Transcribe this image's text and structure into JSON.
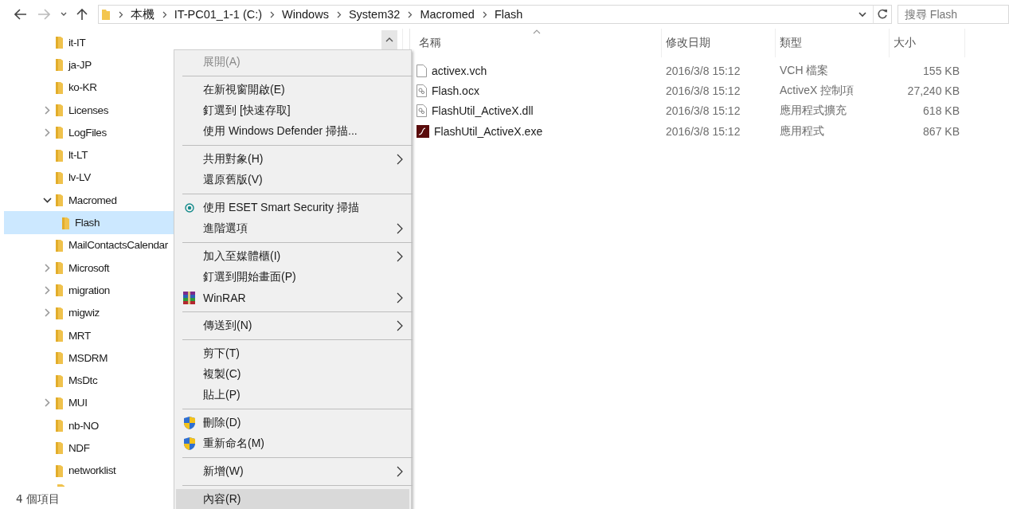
{
  "address": {
    "segments": [
      "本機",
      "IT-PC01_1-1 (C:)",
      "Windows",
      "System32",
      "Macromed",
      "Flash"
    ]
  },
  "search": {
    "placeholder": "搜尋 Flash"
  },
  "nav_tree": [
    {
      "label": "it-IT",
      "expandable": false,
      "selected": false
    },
    {
      "label": "ja-JP",
      "expandable": false,
      "selected": false
    },
    {
      "label": "ko-KR",
      "expandable": false,
      "selected": false
    },
    {
      "label": "Licenses",
      "expandable": true,
      "expanded": false,
      "selected": false
    },
    {
      "label": "LogFiles",
      "expandable": true,
      "expanded": false,
      "selected": false
    },
    {
      "label": "lt-LT",
      "expandable": false,
      "selected": false
    },
    {
      "label": "lv-LV",
      "expandable": false,
      "selected": false
    },
    {
      "label": "Macromed",
      "expandable": true,
      "expanded": true,
      "selected": false,
      "children": [
        {
          "label": "Flash",
          "expandable": false,
          "selected": true
        }
      ]
    },
    {
      "label": "MailContactsCalendar",
      "expandable": false,
      "selected": false
    },
    {
      "label": "Microsoft",
      "expandable": true,
      "expanded": false,
      "selected": false
    },
    {
      "label": "migration",
      "expandable": true,
      "expanded": false,
      "selected": false
    },
    {
      "label": "migwiz",
      "expandable": true,
      "expanded": false,
      "selected": false
    },
    {
      "label": "MRT",
      "expandable": false,
      "selected": false
    },
    {
      "label": "MSDRM",
      "expandable": false,
      "selected": false
    },
    {
      "label": "MsDtc",
      "expandable": false,
      "selected": false
    },
    {
      "label": "MUI",
      "expandable": true,
      "expanded": false,
      "selected": false
    },
    {
      "label": "nb-NO",
      "expandable": false,
      "selected": false
    },
    {
      "label": "NDF",
      "expandable": false,
      "selected": false
    },
    {
      "label": "networklist",
      "expandable": false,
      "selected": false
    }
  ],
  "file_list": {
    "columns": [
      {
        "label": "名稱",
        "sorted": true
      },
      {
        "label": "修改日期",
        "sorted": false
      },
      {
        "label": "類型",
        "sorted": false
      },
      {
        "label": "大小",
        "sorted": false
      }
    ],
    "rows": [
      {
        "kind": "file",
        "name": "activex.vch",
        "modified": "2016/3/8 15:12",
        "type": "VCH 檔案",
        "size": "155 KB"
      },
      {
        "kind": "library",
        "name": "Flash.ocx",
        "modified": "2016/3/8 15:12",
        "type": "ActiveX 控制項",
        "size": "27,240 KB"
      },
      {
        "kind": "library",
        "name": "FlashUtil_ActiveX.dll",
        "modified": "2016/3/8 15:12",
        "type": "應用程式擴充",
        "size": "618 KB"
      },
      {
        "kind": "flash",
        "name": "FlashUtil_ActiveX.exe",
        "modified": "2016/3/8 15:12",
        "type": "應用程式",
        "size": "867 KB"
      }
    ]
  },
  "context_menu": [
    [
      {
        "label": "展開(A)",
        "disabled": true,
        "submenu": false,
        "selected": false
      }
    ],
    [
      {
        "label": "在新視窗開啟(E)",
        "disabled": false,
        "submenu": false,
        "selected": false
      },
      {
        "label": "釘選到 [快速存取]",
        "disabled": false,
        "submenu": false,
        "selected": false
      },
      {
        "label": "使用 Windows Defender 掃描...",
        "disabled": false,
        "submenu": false,
        "selected": false
      }
    ],
    [
      {
        "label": "共用對象(H)",
        "disabled": false,
        "submenu": true,
        "selected": false
      },
      {
        "label": "還原舊版(V)",
        "disabled": false,
        "submenu": false,
        "selected": false
      }
    ],
    [
      {
        "label": "使用 ESET Smart Security 掃描",
        "disabled": false,
        "submenu": false,
        "selected": false,
        "kind": "scan"
      },
      {
        "label": "進階選項",
        "disabled": false,
        "submenu": true,
        "selected": false
      }
    ],
    [
      {
        "label": "加入至媒體櫃(I)",
        "disabled": false,
        "submenu": true,
        "selected": false
      },
      {
        "label": "釘選到開始畫面(P)",
        "disabled": false,
        "submenu": false,
        "selected": false
      },
      {
        "label": "WinRAR",
        "disabled": false,
        "submenu": true,
        "selected": false,
        "kind": "archive"
      }
    ],
    [
      {
        "label": "傳送到(N)",
        "disabled": false,
        "submenu": true,
        "selected": false
      }
    ],
    [
      {
        "label": "剪下(T)",
        "disabled": false,
        "submenu": false,
        "selected": false
      },
      {
        "label": "複製(C)",
        "disabled": false,
        "submenu": false,
        "selected": false
      },
      {
        "label": "貼上(P)",
        "disabled": false,
        "submenu": false,
        "selected": false
      }
    ],
    [
      {
        "label": "刪除(D)",
        "disabled": false,
        "submenu": false,
        "selected": false,
        "kind": "elevated"
      },
      {
        "label": "重新命名(M)",
        "disabled": false,
        "submenu": false,
        "selected": false,
        "kind": "elevated"
      }
    ],
    [
      {
        "label": "新增(W)",
        "disabled": false,
        "submenu": true,
        "selected": false
      }
    ],
    [
      {
        "label": "內容(R)",
        "disabled": false,
        "submenu": false,
        "selected": true
      }
    ]
  ],
  "status_bar": {
    "item_count": "4 個項目"
  }
}
